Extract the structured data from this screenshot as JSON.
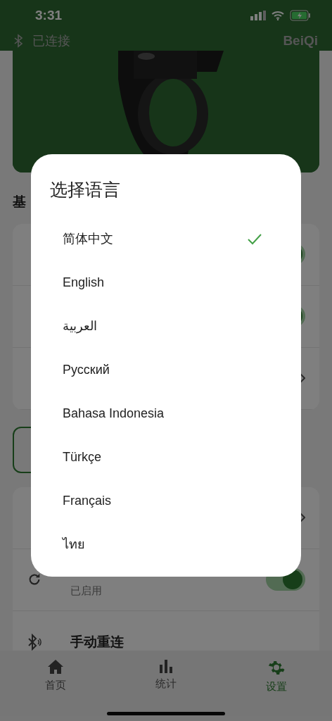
{
  "status_bar": {
    "time": "3:31"
  },
  "header": {
    "connection": "已连接",
    "brand": "BeiQi"
  },
  "section_title": "基",
  "settings_group_1": [
    {
      "kind": "switch",
      "on": true
    },
    {
      "kind": "switch",
      "on": true
    },
    {
      "kind": "chevron"
    }
  ],
  "settings_group_2": [
    {
      "kind": "chevron"
    },
    {
      "kind": "switch",
      "subtitle": "已启用",
      "on": true
    },
    {
      "kind": "plain",
      "title": "手动重连"
    }
  ],
  "language_dialog": {
    "title": "选择语言",
    "options": [
      {
        "label": "简体中文",
        "selected": true
      },
      {
        "label": "English",
        "selected": false
      },
      {
        "label": "العربية",
        "selected": false
      },
      {
        "label": "Русский",
        "selected": false
      },
      {
        "label": "Bahasa Indonesia",
        "selected": false
      },
      {
        "label": "Türkçe",
        "selected": false
      },
      {
        "label": "Français",
        "selected": false
      },
      {
        "label": "ไทย",
        "selected": false
      }
    ]
  },
  "bottom_nav": [
    {
      "label": "首页",
      "selected": false
    },
    {
      "label": "统计",
      "selected": false
    },
    {
      "label": "设置",
      "selected": true
    }
  ]
}
